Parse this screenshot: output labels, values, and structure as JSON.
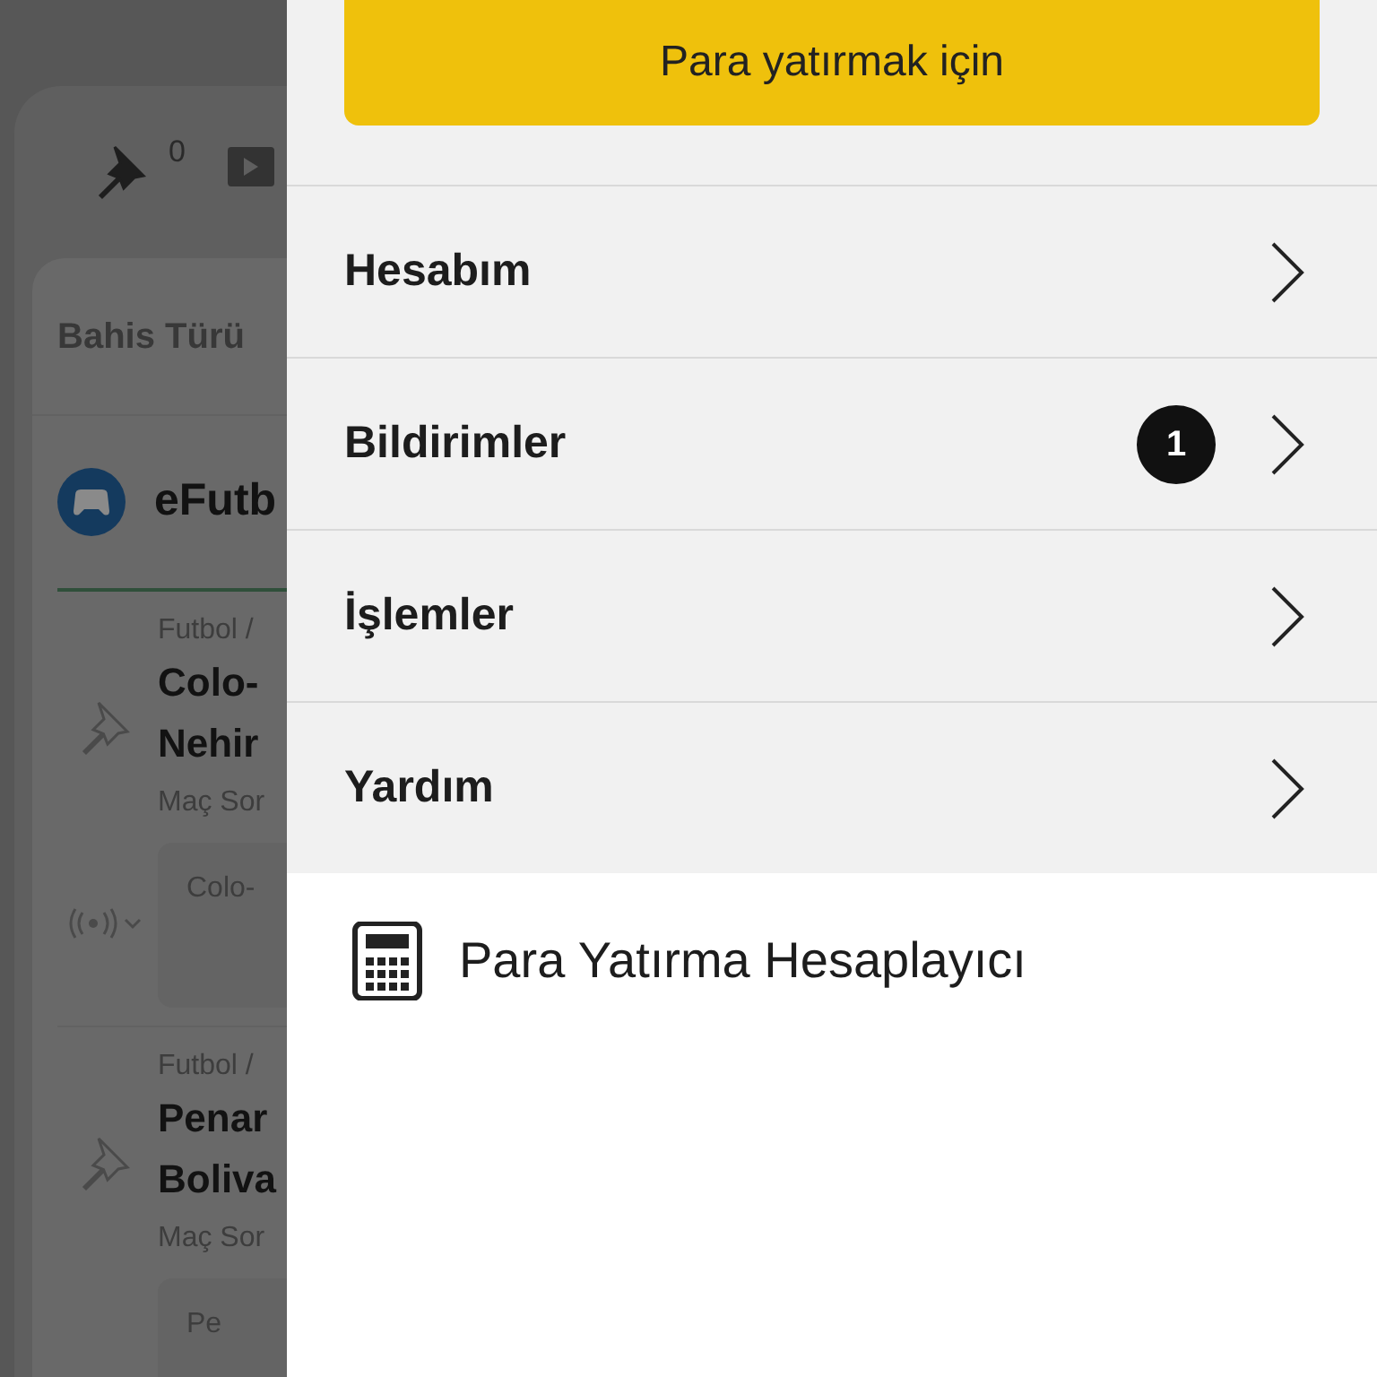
{
  "background": {
    "pin_count": "0",
    "section_title": "Bahis Türü",
    "category": "eFutb",
    "events": [
      {
        "breadcrumb": "Futbol /",
        "teams": [
          "Colo-",
          "Nehir"
        ],
        "market": "Maç Sor",
        "selection": "Colo-",
        "live": true
      },
      {
        "breadcrumb": "Futbol /",
        "teams": [
          "Penar",
          "Boliva"
        ],
        "market": "Maç Sor",
        "selection": "Pe",
        "live": false
      }
    ]
  },
  "menu": {
    "deposit_button": "Para yatırmak için",
    "items": [
      {
        "label": "Hesabım"
      },
      {
        "label": "Bildirimler",
        "badge": "1"
      },
      {
        "label": "İşlemler"
      },
      {
        "label": "Yardım"
      }
    ],
    "calculator": "Para Yatırma Hesaplayıcı"
  }
}
